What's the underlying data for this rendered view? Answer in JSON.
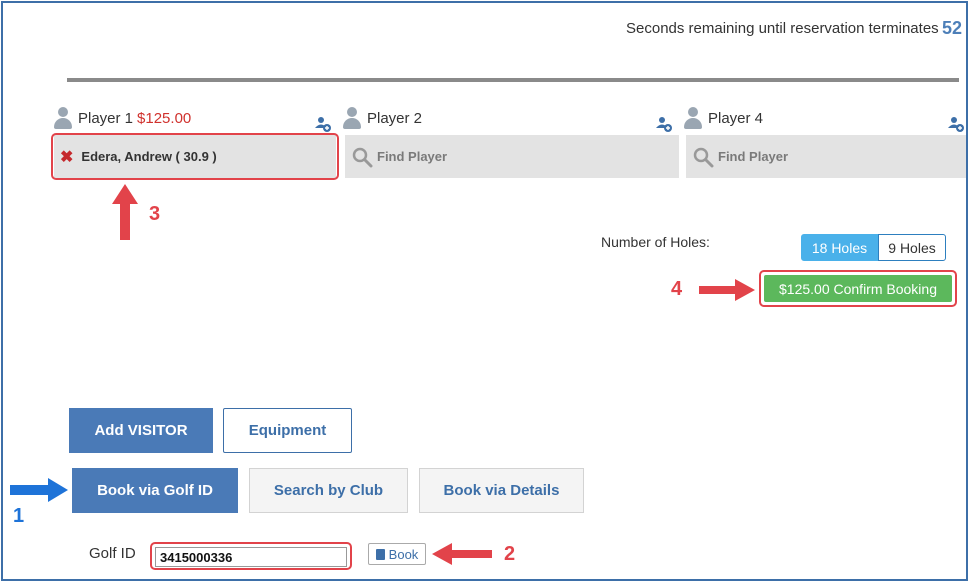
{
  "countdown": {
    "label": "Seconds remaining until reservation terminates",
    "value": "52"
  },
  "players": [
    {
      "label": "Player 1",
      "price": "$125.00",
      "name": "Edera, Andrew ( 30.9 )"
    },
    {
      "label": "Player 2",
      "placeholder": "Find Player"
    },
    {
      "label": "Player 4",
      "placeholder": "Find Player"
    }
  ],
  "holes": {
    "label": "Number of Holes:",
    "options": [
      "18 Holes",
      "9 Holes"
    ],
    "selected": "18 Holes"
  },
  "confirm": {
    "label": "$125.00 Confirm Booking"
  },
  "actions": {
    "add_visitor": "Add VISITOR",
    "equipment": "Equipment"
  },
  "tabs": [
    "Book via Golf ID",
    "Search by Club",
    "Book via Details"
  ],
  "golf_id": {
    "label": "Golf ID",
    "value": "3415000336",
    "book": "Book"
  },
  "callouts": [
    "1",
    "2",
    "3",
    "4"
  ],
  "colors": {
    "accent": "#4a7ab7",
    "confirm": "#5cb85c",
    "highlight": "#e2434a",
    "pointer_blue": "#1e73d8"
  }
}
